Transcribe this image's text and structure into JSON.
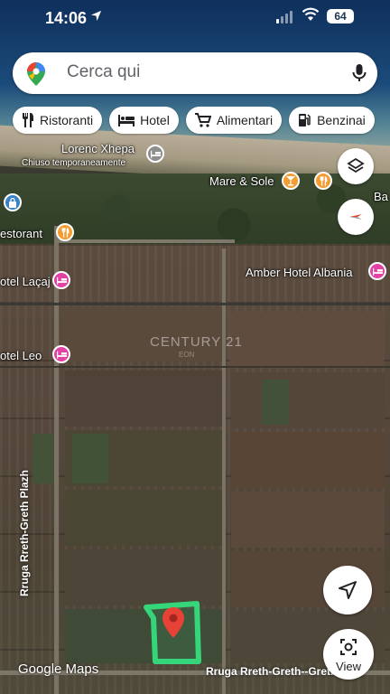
{
  "status": {
    "time": "14:06",
    "battery": "64"
  },
  "search": {
    "placeholder": "Cerca qui"
  },
  "chips": [
    {
      "label": "Ristoranti",
      "icon": "restaurant-icon"
    },
    {
      "label": "Hotel",
      "icon": "hotel-bed-icon"
    },
    {
      "label": "Alimentari",
      "icon": "shopping-cart-icon"
    },
    {
      "label": "Benzinai",
      "icon": "gas-station-icon"
    }
  ],
  "map_labels": {
    "lorenc": "Lorenc Xhepa",
    "lorenc_sub": "Chiuso temporaneamente",
    "mare_sole": "Mare & Sole",
    "ba": "Ba",
    "restorant": "estorant",
    "laca": "otel Laçaj",
    "amber": "Amber Hotel Albania",
    "leo": "otel Leo",
    "watermark": "CENTURY 21",
    "watermark_sub": "EON",
    "street_vertical": "Rruga Rreth-Greth Plazh",
    "street_bottom": "Rruga Rreth-Greth--Greth Mes"
  },
  "footer": {
    "logo": "Google Maps",
    "view_label": "View"
  },
  "colors": {
    "hotel_poi": "#e242a4",
    "food_poi": "#f29c32",
    "hotel_gray": "#8e8e8e",
    "shopping_poi": "#3b82c4",
    "plot_outline": "#35d67a",
    "pin": "#e74236"
  }
}
